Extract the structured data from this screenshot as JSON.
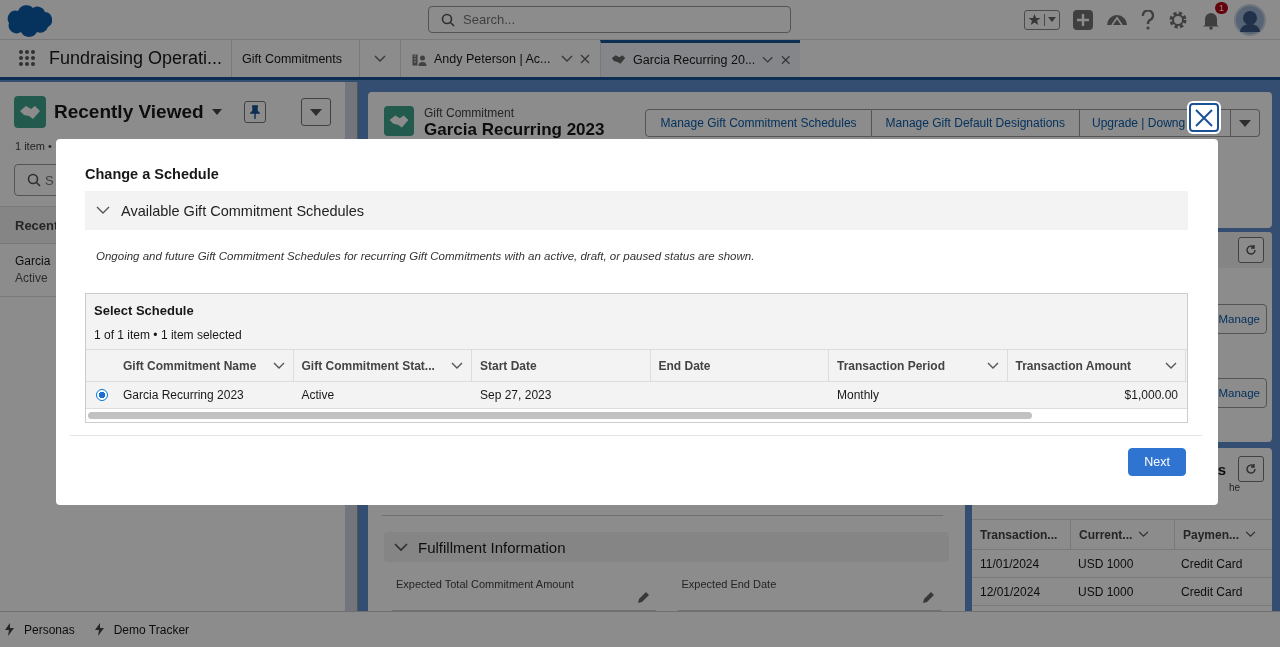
{
  "header": {
    "search": {
      "placeholder": "Search..."
    },
    "notifications": {
      "count": "1"
    }
  },
  "tabs": [
    {
      "label": "Gift Commitments",
      "closable": false,
      "selected": false
    },
    {
      "label": "Andy Peterson | Ac...",
      "closable": true,
      "selected": false
    },
    {
      "label": "Garcia Recurring 20...",
      "closable": true,
      "selected": true
    }
  ],
  "app_name": "Fundraising Operati...",
  "sidebar": {
    "title": "Recently Viewed",
    "count": "1 item •",
    "search": {
      "placeholder": "S"
    },
    "column": "Recent",
    "items": [
      {
        "name": "Garcia",
        "status": "Active"
      }
    ]
  },
  "record": {
    "type": "Gift Commitment",
    "title": "Garcia Recurring 2023",
    "actions": [
      "Manage Gift Commitment Schedules",
      "Manage Gift Default Designations",
      "Upgrade | Downg"
    ]
  },
  "side_card": {
    "buttons": [
      "Manage",
      "Manage"
    ]
  },
  "schedules_card": {
    "title": "s",
    "note": "he",
    "columns": [
      {
        "label": "Transaction...",
        "menu": false
      },
      {
        "label": "Current...",
        "menu": true
      },
      {
        "label": "Paymen...",
        "menu": true
      }
    ],
    "rows": [
      [
        "11/01/2024",
        "USD 1000",
        "Credit Card"
      ],
      [
        "12/01/2024",
        "USD 1000",
        "Credit Card"
      ]
    ]
  },
  "fulfillment": {
    "title": "Fulfillment Information",
    "expanded": true,
    "fields": [
      "Expected Total Commitment Amount",
      "Expected End Date"
    ]
  },
  "utility_bar": [
    "Personas",
    "Demo Tracker"
  ],
  "modal": {
    "title": "Change a Schedule",
    "section": {
      "title": "Available Gift Commitment Schedules",
      "expanded": true
    },
    "description": "Ongoing and future Gift Commitment Schedules for recurring Gift Commitments with an active, draft, or paused status are shown.",
    "table": {
      "title": "Select Schedule",
      "count": "1 of 1 item • 1 item selected",
      "columns": [
        {
          "label": "Gift Commitment Name",
          "menu": true
        },
        {
          "label": "Gift Commitment Stat...",
          "menu": true
        },
        {
          "label": "Start Date",
          "menu": false
        },
        {
          "label": "End Date",
          "menu": false
        },
        {
          "label": "Transaction Period",
          "menu": true
        },
        {
          "label": "Transaction Amount",
          "menu": true
        }
      ],
      "rows": [
        {
          "selected": true,
          "cells": [
            "Garcia Recurring 2023",
            "Active",
            "Sep 27, 2023",
            "",
            "Monthly",
            "$1,000.00"
          ]
        }
      ]
    },
    "buttons": [
      "Next"
    ]
  }
}
